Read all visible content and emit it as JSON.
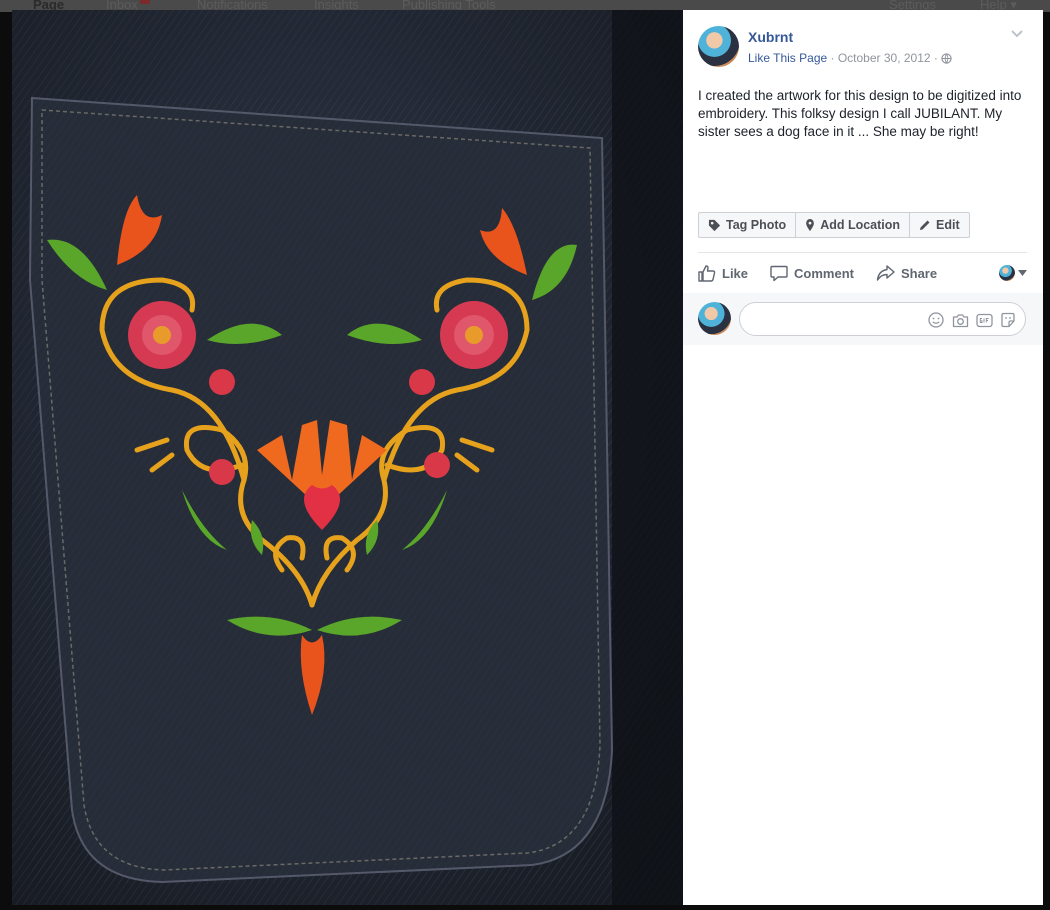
{
  "topnav": {
    "items": [
      "Page",
      "Inbox",
      "Notifications",
      "Insights",
      "Publishing Tools",
      "Settings",
      "Help ▾"
    ]
  },
  "post": {
    "author": "Xubrnt",
    "like_page": "Like This Page",
    "separator": " · ",
    "date": "October 30, 2012",
    "caption": "I created the artwork for this design to be digitized into embroidery. This folksy design I call JUBILANT. My sister sees a dog face in it ... She may be right!"
  },
  "photo_actions": {
    "tag_photo": "Tag Photo",
    "add_location": "Add Location",
    "edit": "Edit"
  },
  "ufi": {
    "like": "Like",
    "comment": "Comment",
    "share": "Share"
  },
  "comment_box": {
    "placeholder": ""
  },
  "colors": {
    "link": "#365899",
    "meta": "#90949c",
    "text": "#1d2129",
    "panel_bg": "#ffffff",
    "backdrop": "#0c0c0c"
  }
}
